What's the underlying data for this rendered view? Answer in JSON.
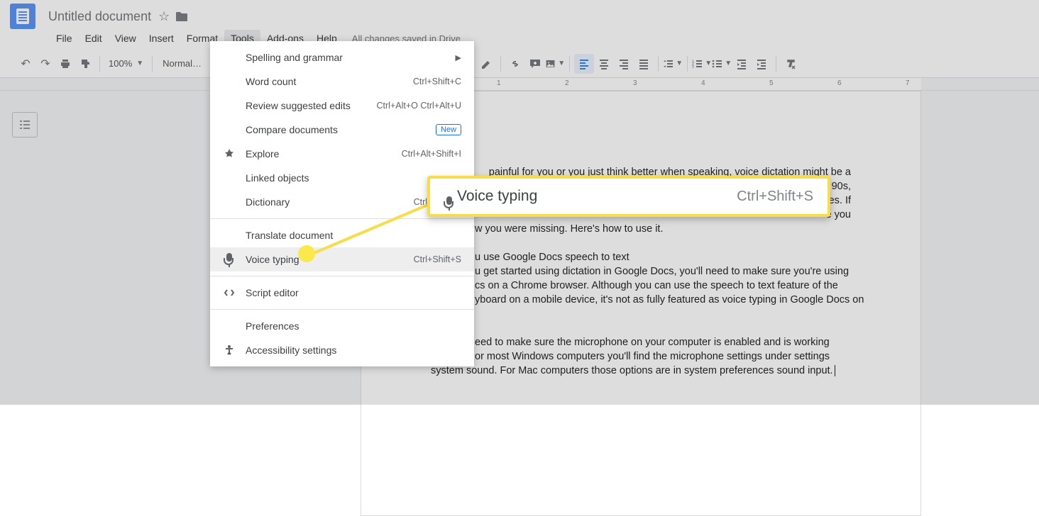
{
  "doc": {
    "title": "Untitled document"
  },
  "menubar": {
    "file": "File",
    "edit": "Edit",
    "view": "View",
    "insert": "Insert",
    "format": "Format",
    "tools": "Tools",
    "addons": "Add-ons",
    "help": "Help",
    "save_status": "All changes saved in Drive"
  },
  "toolbar": {
    "zoom": "100%",
    "style": "Normal…"
  },
  "ruler": {
    "nums": [
      "1",
      "2",
      "3",
      "4",
      "5",
      "6",
      "7"
    ]
  },
  "tools_menu": {
    "spelling": {
      "label": "Spelling and grammar"
    },
    "wordcount": {
      "label": "Word count",
      "shortcut": "Ctrl+Shift+C"
    },
    "review": {
      "label": "Review suggested edits",
      "shortcut": "Ctrl+Alt+O Ctrl+Alt+U"
    },
    "compare": {
      "label": "Compare documents",
      "badge": "New"
    },
    "explore": {
      "label": "Explore",
      "shortcut": "Ctrl+Alt+Shift+I"
    },
    "linked": {
      "label": "Linked objects"
    },
    "dictionary": {
      "label": "Dictionary",
      "shortcut": "Ctrl+Shift+Y"
    },
    "translate": {
      "label": "Translate document"
    },
    "voice": {
      "label": "Voice typing",
      "shortcut": "Ctrl+Shift+S"
    },
    "script": {
      "label": "Script editor"
    },
    "prefs": {
      "label": "Preferences"
    },
    "access": {
      "label": "Accessibility settings"
    }
  },
  "callout": {
    "label": "Voice typing",
    "shortcut": "Ctrl+Shift+S"
  },
  "page_text": {
    "p1": "painful for you or you just think better  when speaking, voice dictation might be  a",
    "p1b": "arly 90s,",
    "p1c": "evices. If",
    "p1d": "e you",
    "p2": "w you were missing.   Here's how to use  it.",
    "h1": "u use Google Docs speech to text",
    "p3": "u get started using dictation in Google Docs, you'll need to make sure you're using",
    "p4": "cs on a Chrome browser. Although you can use the speech to text feature of the",
    "p5": "yboard on a mobile device, it's not as fully featured as voice typing in Google Docs on",
    "p6": "eed to make sure the microphone on your computer is enabled and is working",
    "p7": "or most Windows computers you'll find the microphone settings under settings",
    "p8": "system sound. For Mac computers those options are in system preferences sound input."
  }
}
